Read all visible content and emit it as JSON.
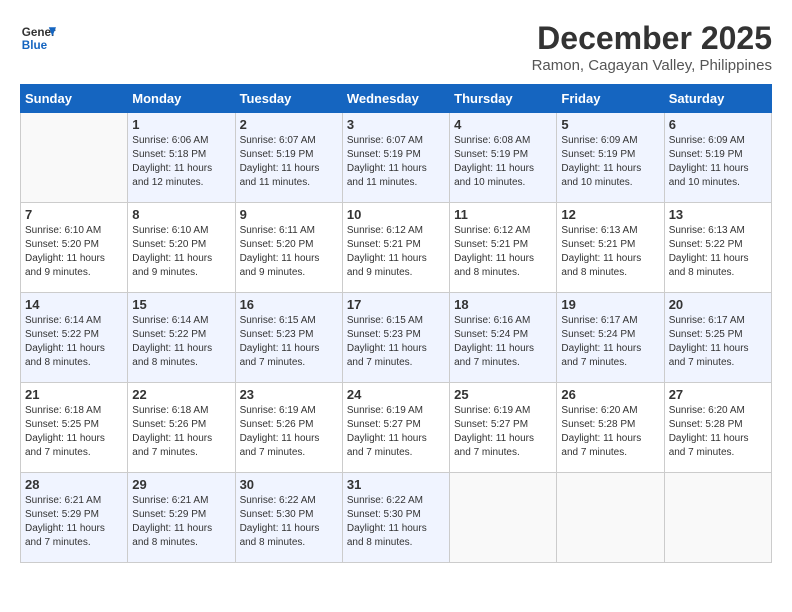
{
  "logo": {
    "line1": "General",
    "line2": "Blue"
  },
  "title": "December 2025",
  "location": "Ramon, Cagayan Valley, Philippines",
  "header": {
    "days": [
      "Sunday",
      "Monday",
      "Tuesday",
      "Wednesday",
      "Thursday",
      "Friday",
      "Saturday"
    ]
  },
  "weeks": [
    [
      {
        "day": "",
        "sunrise": "",
        "sunset": "",
        "daylight": ""
      },
      {
        "day": "1",
        "sunrise": "Sunrise: 6:06 AM",
        "sunset": "Sunset: 5:18 PM",
        "daylight": "Daylight: 11 hours and 12 minutes."
      },
      {
        "day": "2",
        "sunrise": "Sunrise: 6:07 AM",
        "sunset": "Sunset: 5:19 PM",
        "daylight": "Daylight: 11 hours and 11 minutes."
      },
      {
        "day": "3",
        "sunrise": "Sunrise: 6:07 AM",
        "sunset": "Sunset: 5:19 PM",
        "daylight": "Daylight: 11 hours and 11 minutes."
      },
      {
        "day": "4",
        "sunrise": "Sunrise: 6:08 AM",
        "sunset": "Sunset: 5:19 PM",
        "daylight": "Daylight: 11 hours and 10 minutes."
      },
      {
        "day": "5",
        "sunrise": "Sunrise: 6:09 AM",
        "sunset": "Sunset: 5:19 PM",
        "daylight": "Daylight: 11 hours and 10 minutes."
      },
      {
        "day": "6",
        "sunrise": "Sunrise: 6:09 AM",
        "sunset": "Sunset: 5:19 PM",
        "daylight": "Daylight: 11 hours and 10 minutes."
      }
    ],
    [
      {
        "day": "7",
        "sunrise": "Sunrise: 6:10 AM",
        "sunset": "Sunset: 5:20 PM",
        "daylight": "Daylight: 11 hours and 9 minutes."
      },
      {
        "day": "8",
        "sunrise": "Sunrise: 6:10 AM",
        "sunset": "Sunset: 5:20 PM",
        "daylight": "Daylight: 11 hours and 9 minutes."
      },
      {
        "day": "9",
        "sunrise": "Sunrise: 6:11 AM",
        "sunset": "Sunset: 5:20 PM",
        "daylight": "Daylight: 11 hours and 9 minutes."
      },
      {
        "day": "10",
        "sunrise": "Sunrise: 6:12 AM",
        "sunset": "Sunset: 5:21 PM",
        "daylight": "Daylight: 11 hours and 9 minutes."
      },
      {
        "day": "11",
        "sunrise": "Sunrise: 6:12 AM",
        "sunset": "Sunset: 5:21 PM",
        "daylight": "Daylight: 11 hours and 8 minutes."
      },
      {
        "day": "12",
        "sunrise": "Sunrise: 6:13 AM",
        "sunset": "Sunset: 5:21 PM",
        "daylight": "Daylight: 11 hours and 8 minutes."
      },
      {
        "day": "13",
        "sunrise": "Sunrise: 6:13 AM",
        "sunset": "Sunset: 5:22 PM",
        "daylight": "Daylight: 11 hours and 8 minutes."
      }
    ],
    [
      {
        "day": "14",
        "sunrise": "Sunrise: 6:14 AM",
        "sunset": "Sunset: 5:22 PM",
        "daylight": "Daylight: 11 hours and 8 minutes."
      },
      {
        "day": "15",
        "sunrise": "Sunrise: 6:14 AM",
        "sunset": "Sunset: 5:22 PM",
        "daylight": "Daylight: 11 hours and 8 minutes."
      },
      {
        "day": "16",
        "sunrise": "Sunrise: 6:15 AM",
        "sunset": "Sunset: 5:23 PM",
        "daylight": "Daylight: 11 hours and 7 minutes."
      },
      {
        "day": "17",
        "sunrise": "Sunrise: 6:15 AM",
        "sunset": "Sunset: 5:23 PM",
        "daylight": "Daylight: 11 hours and 7 minutes."
      },
      {
        "day": "18",
        "sunrise": "Sunrise: 6:16 AM",
        "sunset": "Sunset: 5:24 PM",
        "daylight": "Daylight: 11 hours and 7 minutes."
      },
      {
        "day": "19",
        "sunrise": "Sunrise: 6:17 AM",
        "sunset": "Sunset: 5:24 PM",
        "daylight": "Daylight: 11 hours and 7 minutes."
      },
      {
        "day": "20",
        "sunrise": "Sunrise: 6:17 AM",
        "sunset": "Sunset: 5:25 PM",
        "daylight": "Daylight: 11 hours and 7 minutes."
      }
    ],
    [
      {
        "day": "21",
        "sunrise": "Sunrise: 6:18 AM",
        "sunset": "Sunset: 5:25 PM",
        "daylight": "Daylight: 11 hours and 7 minutes."
      },
      {
        "day": "22",
        "sunrise": "Sunrise: 6:18 AM",
        "sunset": "Sunset: 5:26 PM",
        "daylight": "Daylight: 11 hours and 7 minutes."
      },
      {
        "day": "23",
        "sunrise": "Sunrise: 6:19 AM",
        "sunset": "Sunset: 5:26 PM",
        "daylight": "Daylight: 11 hours and 7 minutes."
      },
      {
        "day": "24",
        "sunrise": "Sunrise: 6:19 AM",
        "sunset": "Sunset: 5:27 PM",
        "daylight": "Daylight: 11 hours and 7 minutes."
      },
      {
        "day": "25",
        "sunrise": "Sunrise: 6:19 AM",
        "sunset": "Sunset: 5:27 PM",
        "daylight": "Daylight: 11 hours and 7 minutes."
      },
      {
        "day": "26",
        "sunrise": "Sunrise: 6:20 AM",
        "sunset": "Sunset: 5:28 PM",
        "daylight": "Daylight: 11 hours and 7 minutes."
      },
      {
        "day": "27",
        "sunrise": "Sunrise: 6:20 AM",
        "sunset": "Sunset: 5:28 PM",
        "daylight": "Daylight: 11 hours and 7 minutes."
      }
    ],
    [
      {
        "day": "28",
        "sunrise": "Sunrise: 6:21 AM",
        "sunset": "Sunset: 5:29 PM",
        "daylight": "Daylight: 11 hours and 7 minutes."
      },
      {
        "day": "29",
        "sunrise": "Sunrise: 6:21 AM",
        "sunset": "Sunset: 5:29 PM",
        "daylight": "Daylight: 11 hours and 8 minutes."
      },
      {
        "day": "30",
        "sunrise": "Sunrise: 6:22 AM",
        "sunset": "Sunset: 5:30 PM",
        "daylight": "Daylight: 11 hours and 8 minutes."
      },
      {
        "day": "31",
        "sunrise": "Sunrise: 6:22 AM",
        "sunset": "Sunset: 5:30 PM",
        "daylight": "Daylight: 11 hours and 8 minutes."
      },
      {
        "day": "",
        "sunrise": "",
        "sunset": "",
        "daylight": ""
      },
      {
        "day": "",
        "sunrise": "",
        "sunset": "",
        "daylight": ""
      },
      {
        "day": "",
        "sunrise": "",
        "sunset": "",
        "daylight": ""
      }
    ]
  ]
}
